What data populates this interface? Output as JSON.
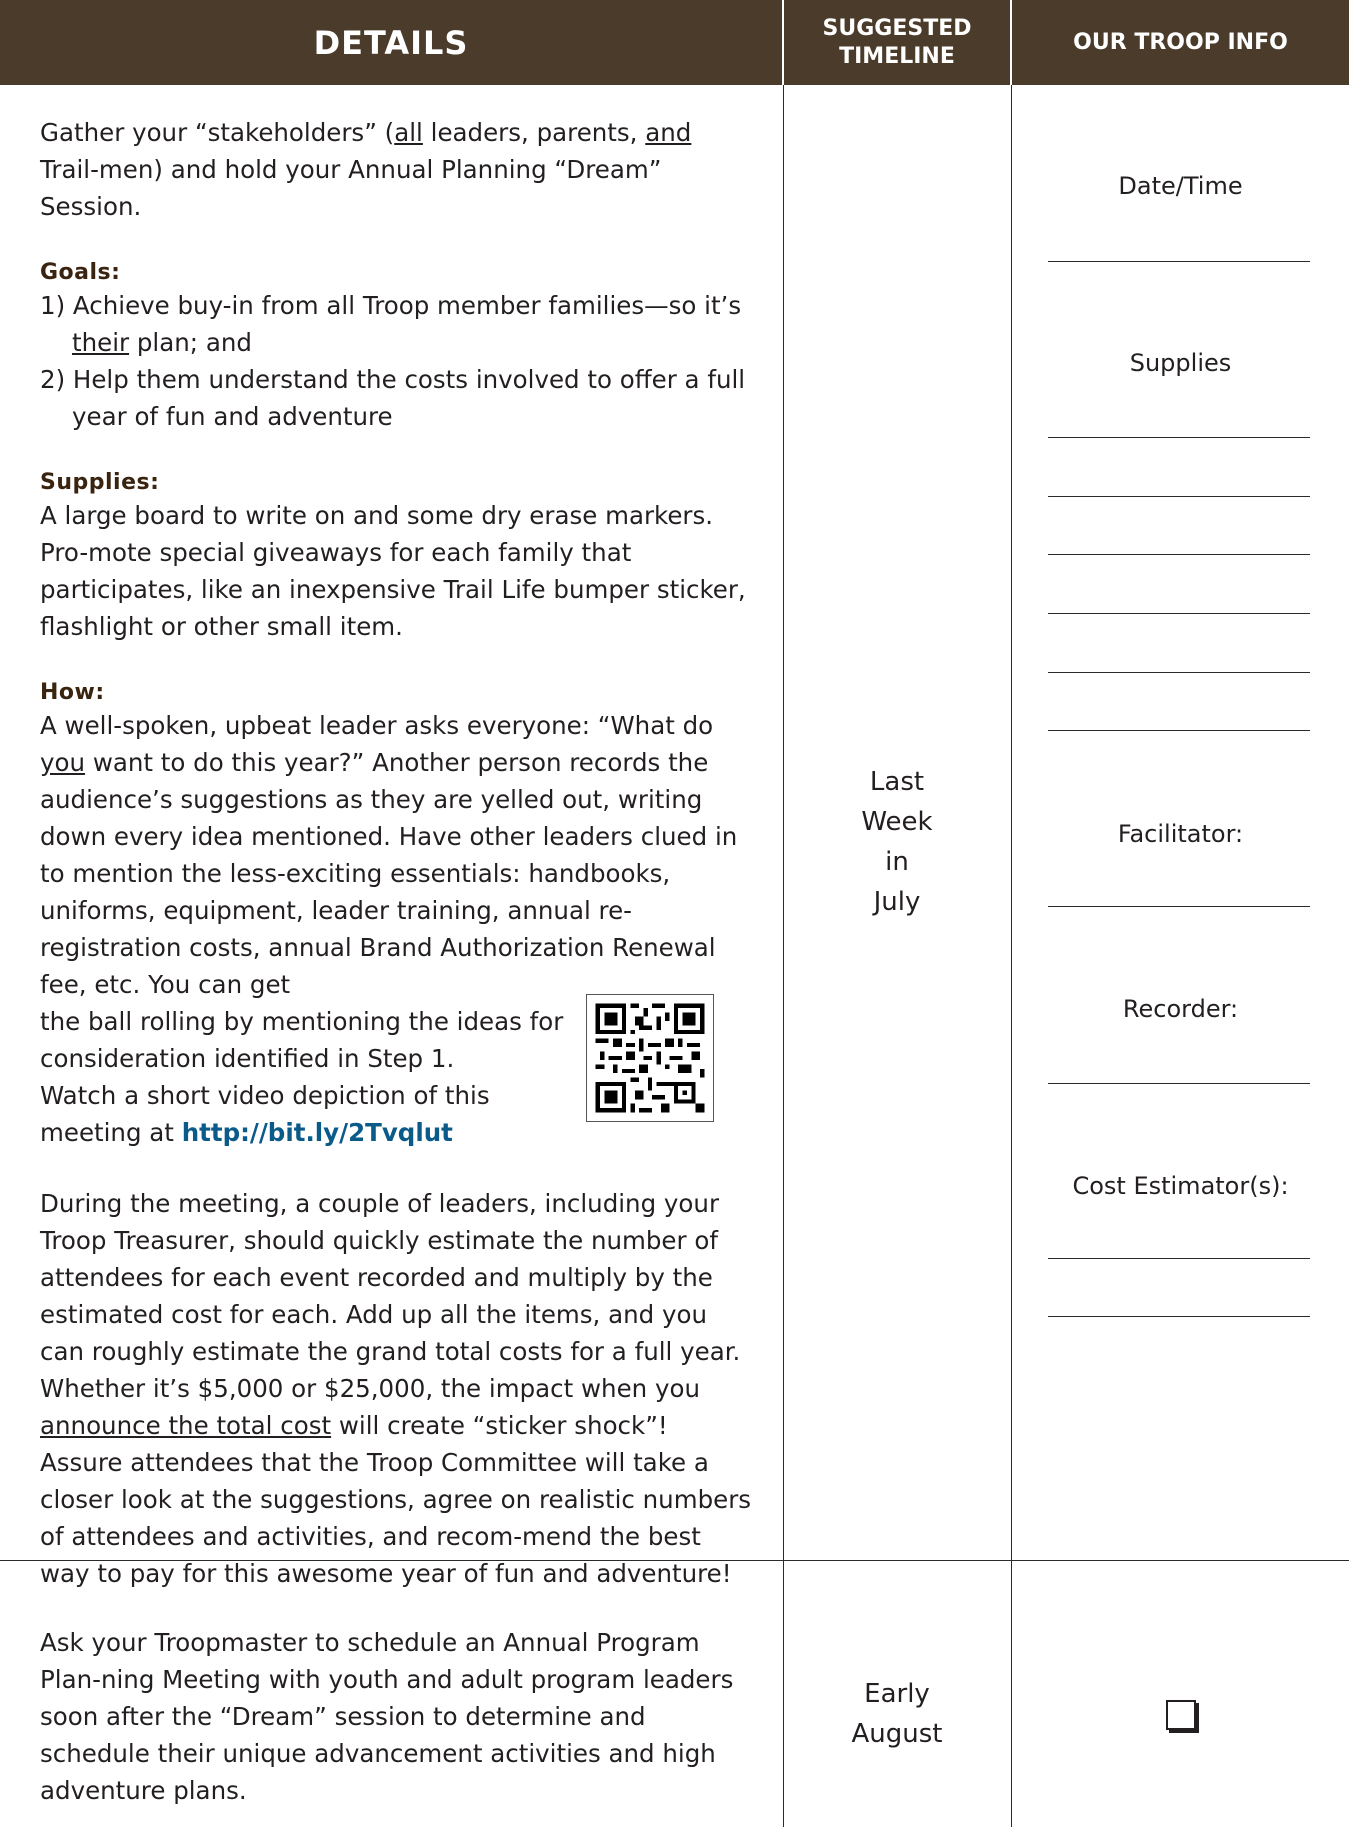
{
  "header": {
    "details": "DETAILS",
    "timeline_line1": "SUGGESTED",
    "timeline_line2": "TIMELINE",
    "troop_info": "OUR TROOP INFO"
  },
  "row1": {
    "intro_a": "Gather your “stakeholders” (",
    "intro_all": "all",
    "intro_b": " leaders, parents, ",
    "intro_and": "and",
    "intro_c": " Trail-men) and hold your Annual Planning “Dream” Session.",
    "goals_heading": "Goals:",
    "goal1_a": "1) Achieve buy-in from all Troop member families—so it’s ",
    "goal1_their": "their",
    "goal1_b": " plan; and",
    "goal2": "2) Help them understand the costs involved to offer a full year of fun and adventure",
    "supplies_heading": "Supplies:",
    "supplies_text": "A large board to write on and some dry erase markers. Pro-mote special giveaways for each family that participates, like an inexpensive Trail Life bumper sticker, flashlight or other small item.",
    "how_heading": "How:",
    "how_a": "A well-spoken, upbeat leader asks everyone: “What do ",
    "how_you": "you",
    "how_b": " want to do this year?” Another person records the audience’s suggestions as they are yelled out, writing down every idea mentioned. Have other leaders clued in to mention the less-exciting essentials: handbooks, uniforms, equipment, leader training, annual re-registration costs, annual Brand Authorization Renewal fee, etc. You can get",
    "how_c1": "the ball rolling by mentioning the ideas for",
    "how_c2": "consideration identified in Step 1.",
    "how_c3": "Watch a short video depiction of this",
    "how_c4": "meeting at ",
    "link": "http://bit.ly/2Tvqlut",
    "during_a": "During the meeting, a couple of leaders, including your Troop Treasurer, should quickly estimate the number of attendees for each event recorded and multiply by the estimated cost for each. Add up all the items, and you can roughly estimate the grand total costs for a full year. Whether it’s $5,000 or $25,000, the impact when you ",
    "during_ul": "announce the total cost",
    "during_b": " will create “sticker shock”! Assure attendees that the Troop Committee will take a closer look at the suggestions, agree on realistic numbers of attendees and activities, and recom-mend the best way to pay for this awesome year of fun and adventure!",
    "timeline": [
      "Last",
      "Week",
      "in",
      "July"
    ],
    "troop_labels": {
      "date_time": "Date/Time",
      "supplies": "Supplies",
      "facilitator": "Facilitator:",
      "recorder": "Recorder:",
      "cost_estimator": "Cost Estimator(s):"
    }
  },
  "row2": {
    "details": "Ask your Troopmaster to schedule an Annual Program Plan-ning Meeting with youth and adult program leaders soon after the “Dream” session to determine and schedule their unique advancement activities and high adventure plans.",
    "timeline": [
      "Early",
      "August"
    ]
  }
}
